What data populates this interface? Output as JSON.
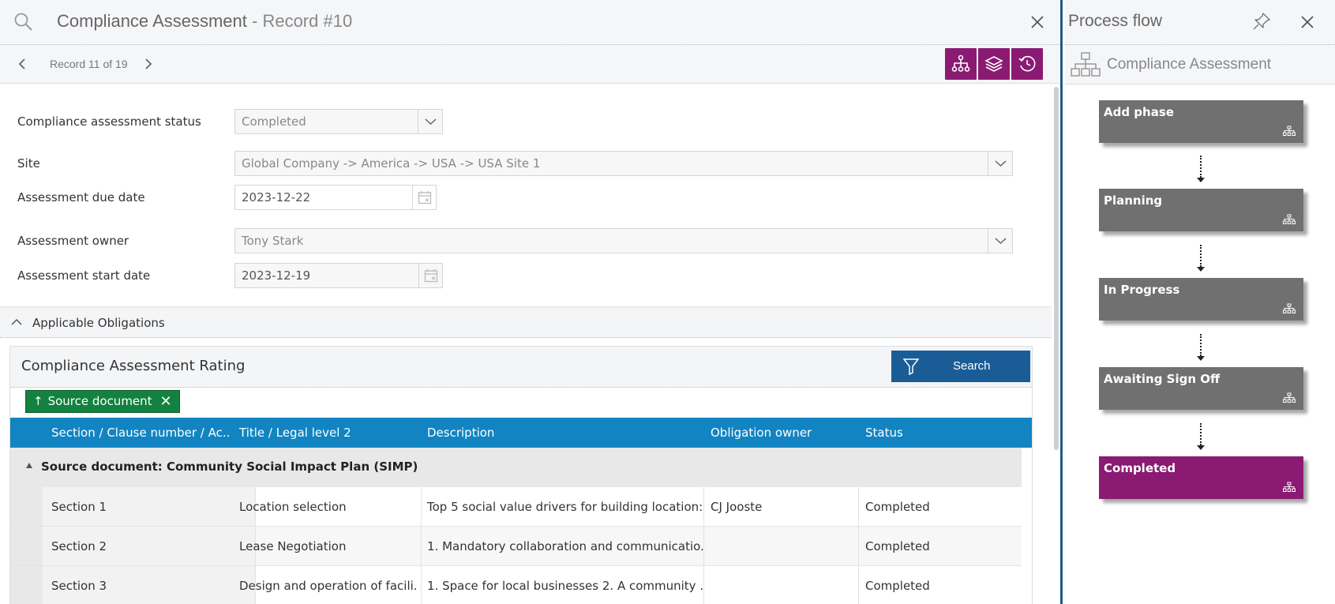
{
  "header": {
    "title": "Compliance Assessment",
    "record_suffix": " - Record #10",
    "record_position": "Record 11 of 19"
  },
  "toolbar": {
    "icons": [
      "process-flow-icon",
      "layers-icon",
      "history-icon"
    ],
    "accent_color": "#8a1a72"
  },
  "form": {
    "status": {
      "label": "Compliance assessment status",
      "value": "Completed"
    },
    "site": {
      "label": "Site",
      "value": "Global Company -> America -> USA -> USA Site 1"
    },
    "due_date": {
      "label": "Assessment due date",
      "value": "2023-12-22"
    },
    "owner": {
      "label": "Assessment owner",
      "value": "Tony Stark"
    },
    "start_date": {
      "label": "Assessment start date",
      "value": "2023-12-19"
    }
  },
  "obligations": {
    "section_title": "Applicable Obligations",
    "grid_title": "Compliance Assessment Rating",
    "search_label": "Search",
    "group_chip": "Source document",
    "columns": [
      "Section / Clause number / Ac...",
      "Title / Legal level 2",
      "Description",
      "Obligation owner",
      "Status"
    ],
    "group_label": "Source document: Community Social Impact Plan (SIMP)",
    "rows": [
      {
        "section": "Section 1",
        "title": "Location selection",
        "description": "Top 5 social value drivers for building location:...",
        "owner": "CJ Jooste",
        "status": "Completed"
      },
      {
        "section": "Section 2",
        "title": "Lease Negotiation",
        "description": "1. Mandatory collaboration and communicatio...",
        "owner": "",
        "status": "Completed"
      },
      {
        "section": "Section 3",
        "title": "Design and operation of facili...",
        "description": "1. Space for local businesses 2. A community ...",
        "owner": "",
        "status": "Completed"
      }
    ],
    "header_color": "#1284c2",
    "chip_color": "#138240"
  },
  "process_flow": {
    "title": "Process flow",
    "subtitle": "Compliance Assessment",
    "phases": [
      "Add phase",
      "Planning",
      "In Progress",
      "Awaiting Sign Off",
      "Completed"
    ],
    "active_phase": "Completed",
    "active_color": "#8a1a72",
    "inactive_color": "#707070"
  }
}
